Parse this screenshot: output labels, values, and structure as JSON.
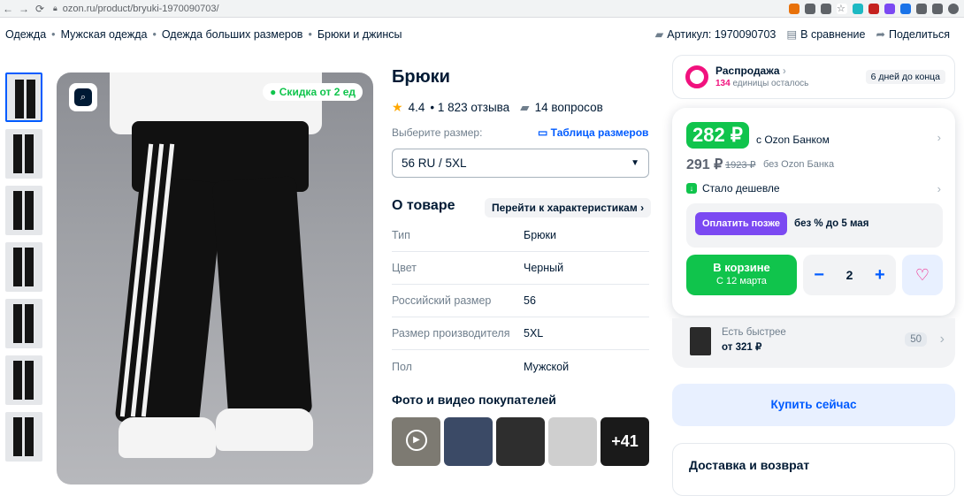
{
  "browser": {
    "url": "ozon.ru/product/bryuki-1970090703/"
  },
  "breadcrumbs": [
    "Одежда",
    "Мужская одежда",
    "Одежда больших размеров",
    "Брюки и джинсы"
  ],
  "top_actions": {
    "article": "Артикул: 1970090703",
    "compare": "В сравнение",
    "share": "Поделиться"
  },
  "product": {
    "discount_badge": "Скидка от 2 ед",
    "title": "Брюки",
    "rating": "4.4",
    "reviews": "• 1 823 отзыва",
    "questions": "14 вопросов",
    "size_label": "Выберите размер:",
    "size_table": "Таблица размеров",
    "selected_size": "56 RU / 5XL",
    "about_title": "О товаре",
    "char_link": "Перейти к характеристикам",
    "specs": [
      {
        "k": "Тип",
        "v": "Брюки"
      },
      {
        "k": "Цвет",
        "v": "Черный"
      },
      {
        "k": "Российский размер",
        "v": "56"
      },
      {
        "k": "Размер производителя",
        "v": "5XL"
      },
      {
        "k": "Пол",
        "v": "Мужской"
      }
    ],
    "photos_title": "Фото и видео покупателей",
    "more_photos": "+41"
  },
  "sale": {
    "title": "Распродажа",
    "count": "134",
    "count_suffix": " единицы осталось",
    "ends": "6 дней до конца"
  },
  "price": {
    "bank_price": "282 ₽",
    "bank_label": "с Ozon Банком",
    "price": "291 ₽",
    "old_price": "1923 ₽",
    "no_bank": "без Ozon Банка",
    "cheaper": "Стало дешевле",
    "pay_later_btn": "Оплатить позже",
    "pay_later_text": "без % до 5 мая",
    "cart_title": "В корзине",
    "cart_sub": "С 12 марта",
    "qty": "2"
  },
  "faster": {
    "title": "Есть быстрее",
    "price": "от 321 ₽",
    "count": "50"
  },
  "buy_now": "Купить сейчас",
  "delivery": "Доставка и возврат"
}
